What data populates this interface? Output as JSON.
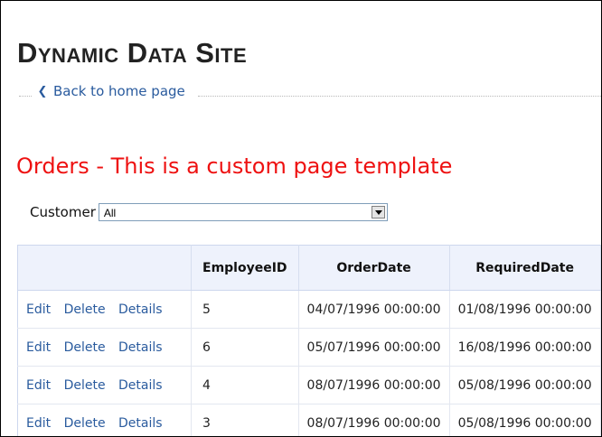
{
  "site": {
    "title": "Dynamic Data Site",
    "back_link": "Back to home page"
  },
  "page": {
    "heading": "Orders - This is a custom page template"
  },
  "filter": {
    "label": "Customer",
    "selected": "All"
  },
  "grid": {
    "actions": {
      "edit": "Edit",
      "delete": "Delete",
      "details": "Details"
    },
    "columns": [
      "",
      "EmployeeID",
      "OrderDate",
      "RequiredDate"
    ],
    "rows": [
      {
        "employee_id": "5",
        "order_date": "04/07/1996 00:00:00",
        "required_date": "01/08/1996 00:00:00"
      },
      {
        "employee_id": "6",
        "order_date": "05/07/1996 00:00:00",
        "required_date": "16/08/1996 00:00:00"
      },
      {
        "employee_id": "4",
        "order_date": "08/07/1996 00:00:00",
        "required_date": "05/08/1996 00:00:00"
      },
      {
        "employee_id": "3",
        "order_date": "08/07/1996 00:00:00",
        "required_date": "05/08/1996 00:00:00"
      }
    ]
  },
  "icons": {
    "back": "chevron-left-icon",
    "dropdown": "chevron-down-icon"
  },
  "colors": {
    "heading": "#ee1111",
    "link": "#2a5b9e",
    "grid_header": "#eef2fc"
  }
}
